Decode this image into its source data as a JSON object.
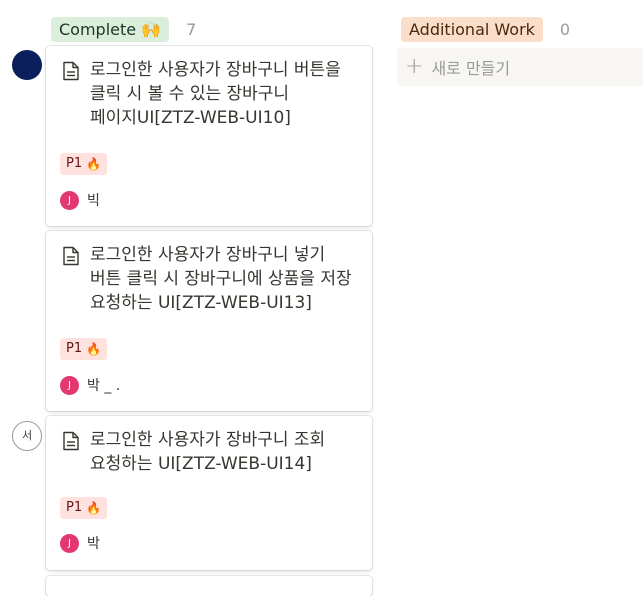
{
  "columns": [
    {
      "label": "Complete 🙌",
      "count": "7"
    },
    {
      "label": "Additional Work",
      "count": "0",
      "new_label": "새로 만들기"
    }
  ],
  "cards": [
    {
      "title": "로그인한 사용자가 장바구니 버튼을 클릭 시 볼 수 있는 장바구니 페이지UI[ZTZ-WEB-UI10]",
      "priority": "P1",
      "avatar": "J",
      "person": "빅"
    },
    {
      "title": "로그인한 사용자가 장바구니 넣기 버튼 클릭 시 장바구니에 상품을 저장 요청하는 UI[ZTZ-WEB-UI13]",
      "priority": "P1",
      "avatar": "J",
      "person": "박 _ ."
    },
    {
      "title": "로그인한 사용자가 장바구니 조회 요청하는 UI[ZTZ-WEB-UI14]",
      "priority": "P1",
      "avatar": "J",
      "person": "박"
    }
  ],
  "side_avatar": "서",
  "icons": {
    "doc": "document-icon",
    "fire": "fire-icon",
    "plus": "plus-icon"
  }
}
